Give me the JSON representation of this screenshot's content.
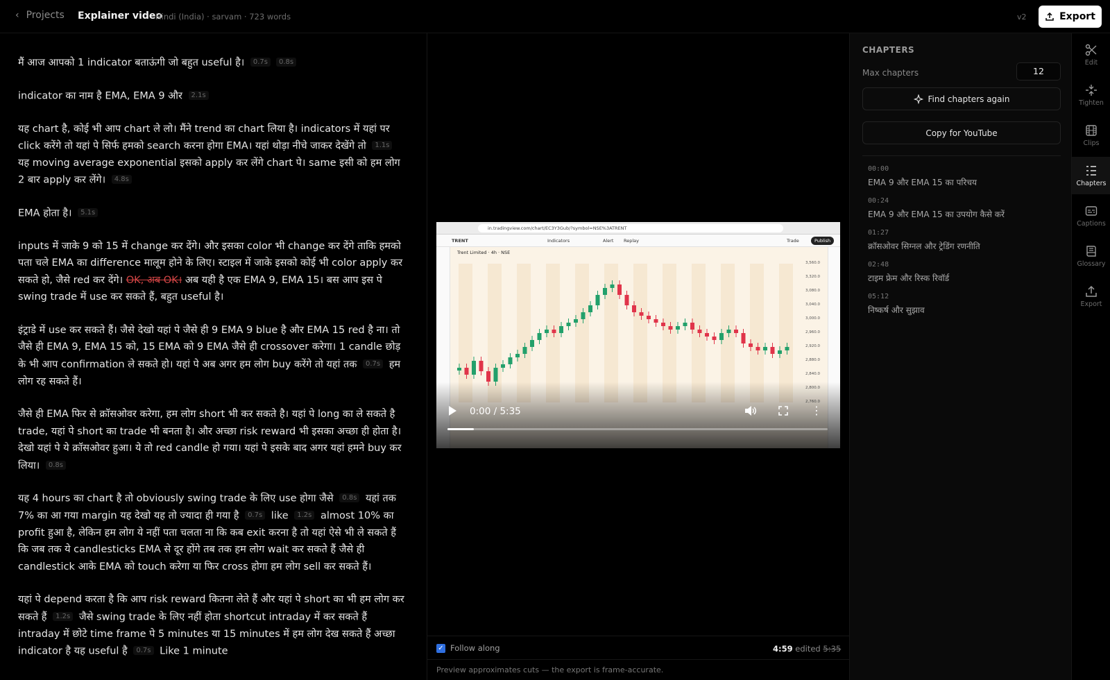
{
  "topbar": {
    "back_label": "Projects",
    "title": "Explainer video",
    "meta": "Hindi (India) · sarvam · 723 words",
    "version": "v2",
    "export_label": "Export"
  },
  "transcript": {
    "p1": {
      "t1": "मैं आज आपको 1 indicator बताऊंगी जो बहुत useful है।",
      "pause1": "0.7s",
      "pause2": "0.8s"
    },
    "p2": {
      "t1": "indicator का नाम है EMA, EMA 9 और",
      "pause1": "2.1s"
    },
    "p3": {
      "t1": "यह chart है, कोई भी आप chart ले लो। मैंने trend का chart लिया है। indicators में यहां पर click करेंगे तो यहां पे सिर्फ हमको search करना होगा EMA। यहां थोड़ा नीचे जाकर देखेंगे तो",
      "pause1": "1.1s",
      "t2": "यह moving average exponential इसको apply कर लेंगे chart पे। same इसी को हम लोग 2 बार apply कर लेंगे।",
      "pause2": "4.8s"
    },
    "p4": {
      "t1": "EMA होता है।",
      "pause1": "5.1s"
    },
    "p5": {
      "t1": "inputs में जाके 9 को 15 में change कर देंगे। और इसका color भी change कर देंगे ताकि हमको पता चले EMA का difference मालूम होने के लिए। स्टाइल में जाके इसको कोई भी color apply कर सकते हो, जैसे red कर देंगे।",
      "struck": "OK, अब OK।",
      "t2": "अब यही है एक EMA 9, EMA 15। बस आप इस पे swing trade में use कर सकते हैं, बहुत useful है।"
    },
    "p6": {
      "t1": "इंट्राडे में use कर सकते हैं। जैसे देखो यहां पे जैसे ही 9 EMA 9 blue है और EMA 15 red है ना। तो जैसे ही EMA 9, EMA 15 को, 15 EMA को 9 EMA जैसे ही crossover करेगा। 1 candle छोड़ के भी आप confirmation ले सकते हो। यहां पे अब अगर हम लोग buy करेंगे तो यहां तक",
      "pause1": "0.7s",
      "t2": "हम लोग रह सकते हैं।"
    },
    "p7": {
      "t1": "जैसे ही EMA फिर से क्रॉसओवर करेगा, हम लोग short भी कर सकते है। यहां पे long का ले सकते है trade, यहां पे short का trade भी बनता है। और अच्छा risk reward भी इसका अच्छा ही होता है। देखो यहां पे ये क्रॉसओवर हुआ। ये तो red candle हो गया। यहां पे इसके बाद अगर यहां हमने buy कर लिया।",
      "pause1": "0.8s"
    },
    "p8": {
      "t1": "यह 4 hours का chart है तो obviously swing trade के लिए use होगा जैसे",
      "pause1": "0.8s",
      "t2": "यहां तक 7% का आ गया margin यह देखो यह तो ज्यादा ही गया है",
      "pause2": "0.7s",
      "t3": "like",
      "pause3": "1.2s",
      "t4": "almost 10% का profit हुआ है, लेकिन हम लोग ये नहीं पता चलता ना कि कब exit करना है तो यहां ऐसे भी ले सकते हैं कि जब तक ये candlesticks EMA से दूर होंगे तब तक हम लोग wait कर सकते हैं जैसे ही candlestick आके EMA को touch करेगा या फिर cross होगा हम लोग sell कर सकते हैं।"
    },
    "p9": {
      "t1": "यहां पे depend करता है कि आप risk reward कितना लेते हैं और यहां पे short का भी हम लोग कर सकते हैं",
      "pause1": "1.2s",
      "t2": "जैसे swing trade के लिए नहीं होता shortcut intraday में कर सकते हैं intraday में छोटे time frame पे 5 minutes या 15 minutes में हम लोग देख सकते हैं अच्छा indicator है यह useful है",
      "pause2": "0.7s",
      "t3": "Like 1 minute"
    }
  },
  "player": {
    "url": "in.tradingview.com/chart/EC3Y3Gub/?symbol=NSE%3ATRENT",
    "symbol": "TRENT",
    "indicators_label": "Indicators",
    "alert_label": "Alert",
    "replay_label": "Replay",
    "trade_label": "Trade",
    "publish_label": "Publish",
    "legend": "Trent Limited · 4h · NSE",
    "price_ticks": [
      "3,560.0",
      "3,320.0",
      "3,080.0",
      "3,040.0",
      "3,000.0",
      "2,960.0",
      "2,920.0",
      "2,880.0",
      "2,840.0",
      "2,800.0",
      "2,760.0"
    ],
    "time_readout": "0:00 / 5:35",
    "progress": 0.07
  },
  "bottom": {
    "follow_label": "Follow along",
    "edited_time": "4:59",
    "edited_label": "edited",
    "original_time": "5:35",
    "note": "Preview approximates cuts — the export is frame-accurate."
  },
  "chapters": {
    "heading": "CHAPTERS",
    "max_label": "Max chapters",
    "max_value": "12",
    "find_label": "Find chapters again",
    "youtube_label": "Copy for YouTube",
    "items": [
      {
        "time": "00:00",
        "title": "EMA 9 और EMA 15 का परिचय"
      },
      {
        "time": "00:24",
        "title": "EMA 9 और EMA 15 का उपयोग कैसे करें"
      },
      {
        "time": "01:27",
        "title": "क्रॉसओवर सिग्नल और ट्रेडिंग रणनीति"
      },
      {
        "time": "02:48",
        "title": "टाइम फ्रेम और रिस्क रिवॉर्ड"
      },
      {
        "time": "05:12",
        "title": "निष्कर्ष और सुझाव"
      }
    ]
  },
  "rail": {
    "items": [
      {
        "label": "Edit",
        "icon": "scissors-icon"
      },
      {
        "label": "Tighten",
        "icon": "tighten-icon"
      },
      {
        "label": "Clips",
        "icon": "film-icon"
      },
      {
        "label": "Chapters",
        "icon": "list-icon"
      },
      {
        "label": "Captions",
        "icon": "captions-icon"
      },
      {
        "label": "Glossary",
        "icon": "book-icon"
      },
      {
        "label": "Export",
        "icon": "upload-icon"
      }
    ],
    "active": "Chapters"
  }
}
